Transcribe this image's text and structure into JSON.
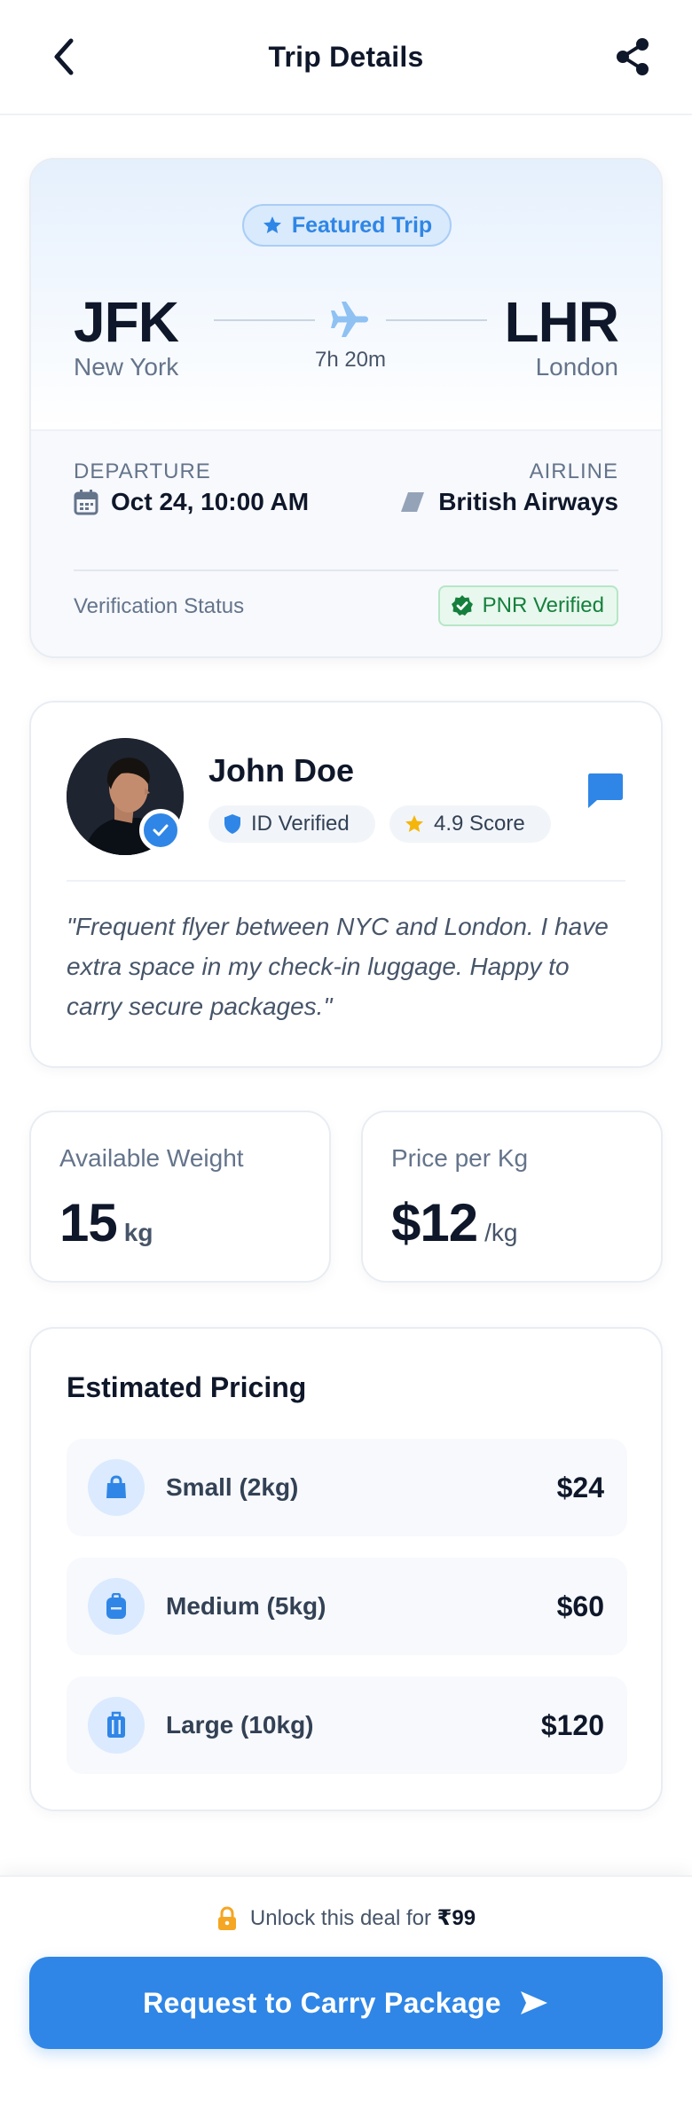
{
  "header": {
    "title": "Trip Details",
    "back_icon": "chevron-left-icon",
    "share_icon": "share-icon"
  },
  "route": {
    "badge": "Featured Trip",
    "from_code": "JFK",
    "from_city": "New York",
    "to_code": "LHR",
    "to_city": "London",
    "duration": "7h 20m",
    "departure_label": "DEPARTURE",
    "departure_value": "Oct 24, 10:00 AM",
    "airline_label": "AIRLINE",
    "airline_value": "British Airways",
    "verification_label": "Verification Status",
    "verification_badge": "PNR Verified"
  },
  "traveler": {
    "name": "John Doe",
    "id_chip": "ID Verified",
    "score_chip": "4.9 Score",
    "bio": "\"Frequent flyer between NYC and London. I have extra space in my check-in luggage. Happy to carry secure packages.\""
  },
  "stats": {
    "weight_label": "Available Weight",
    "weight_value": "15",
    "weight_unit": "kg",
    "price_label": "Price per Kg",
    "price_value": "$12",
    "price_unit": "/kg"
  },
  "pricing": {
    "title": "Estimated Pricing",
    "items": [
      {
        "size": "Small (2kg)",
        "price": "$24",
        "icon": "shopping-bag-icon"
      },
      {
        "size": "Medium (5kg)",
        "price": "$60",
        "icon": "backpack-icon"
      },
      {
        "size": "Large (10kg)",
        "price": "$120",
        "icon": "suitcase-icon"
      }
    ]
  },
  "footer": {
    "unlock_text": "Unlock this deal for",
    "unlock_price": "₹99",
    "cta_label": "Request to Carry Package"
  },
  "colors": {
    "accent": "#2f86e6",
    "success": "#15803d",
    "star": "#f5b50a",
    "lock": "#f5a623"
  }
}
